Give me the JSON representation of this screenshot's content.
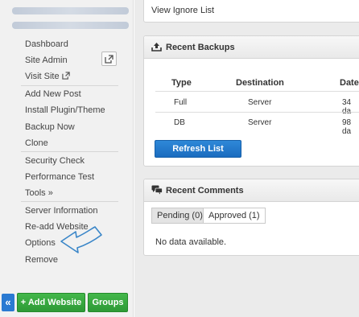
{
  "sidebar": {
    "menu_groups": [
      [
        {
          "label": "Dashboard"
        },
        {
          "label": "Site Admin"
        },
        {
          "label": "Visit Site"
        }
      ],
      [
        {
          "label": "Add New Post"
        },
        {
          "label": "Install Plugin/Theme"
        },
        {
          "label": "Backup Now"
        },
        {
          "label": "Clone"
        }
      ],
      [
        {
          "label": "Security Check"
        },
        {
          "label": "Performance Test"
        },
        {
          "label": "Tools »"
        }
      ],
      [
        {
          "label": "Server Information"
        },
        {
          "label": "Re-add Website"
        },
        {
          "label": "Options"
        },
        {
          "label": "Remove"
        }
      ]
    ],
    "collapse_label": "«",
    "add_website_label": "+ Add Website",
    "groups_label": "Groups"
  },
  "top_panel": {
    "link": "View Ignore List"
  },
  "backups": {
    "title": "Recent Backups",
    "columns": [
      "Type",
      "Destination",
      "Date"
    ],
    "rows": [
      {
        "type": "Full",
        "destination": "Server",
        "date": "34 da"
      },
      {
        "type": "DB",
        "destination": "Server",
        "date": "98 da"
      }
    ],
    "refresh_label": "Refresh List"
  },
  "comments": {
    "title": "Recent Comments",
    "tabs": [
      {
        "label": "Pending (0)",
        "active": true
      },
      {
        "label": "Approved (1)",
        "active": false
      }
    ],
    "empty_text": "No data available."
  },
  "colors": {
    "accent_blue": "#1e73c6",
    "accent_green": "#34a53c",
    "annotation_arrow": "#3a86c8"
  }
}
